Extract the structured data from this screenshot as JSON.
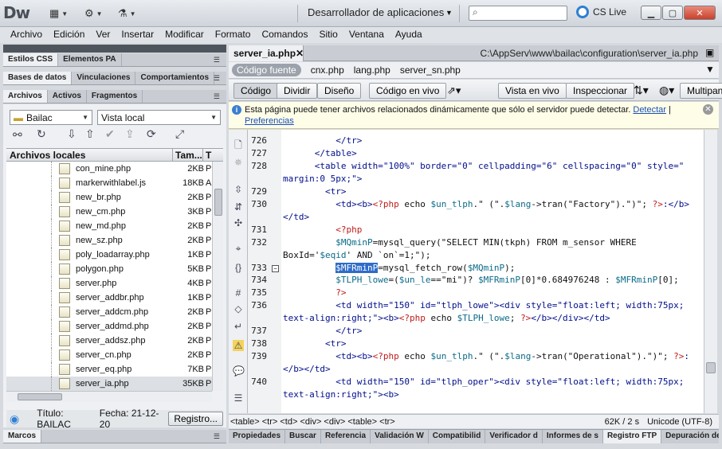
{
  "app": {
    "logo": "Dw",
    "workspace": "Desarrollador de aplicaciones",
    "cs_live": "CS Live"
  },
  "menu": [
    "Archivo",
    "Edición",
    "Ver",
    "Insertar",
    "Modificar",
    "Formato",
    "Comandos",
    "Sitio",
    "Ventana",
    "Ayuda"
  ],
  "panels": {
    "group1": [
      "Estilos CSS",
      "Elementos PA"
    ],
    "group2": [
      "Bases de datos",
      "Vinculaciones",
      "Comportamientos"
    ],
    "group3": [
      "Archivos",
      "Activos",
      "Fragmentos"
    ],
    "site_select": "Bailac",
    "view_select": "Vista local",
    "columns": {
      "name": "Archivos locales",
      "size": "Tam...",
      "type": "T"
    },
    "files": [
      {
        "name": "con_mine.php",
        "size": "2KB",
        "type": "P"
      },
      {
        "name": "markerwithlabel.js",
        "size": "18KB",
        "type": "A"
      },
      {
        "name": "new_br.php",
        "size": "2KB",
        "type": "P"
      },
      {
        "name": "new_cm.php",
        "size": "3KB",
        "type": "P"
      },
      {
        "name": "new_md.php",
        "size": "2KB",
        "type": "P"
      },
      {
        "name": "new_sz.php",
        "size": "2KB",
        "type": "P"
      },
      {
        "name": "poly_loadarray.php",
        "size": "1KB",
        "type": "P"
      },
      {
        "name": "polygon.php",
        "size": "5KB",
        "type": "P"
      },
      {
        "name": "server.php",
        "size": "4KB",
        "type": "P"
      },
      {
        "name": "server_addbr.php",
        "size": "1KB",
        "type": "P"
      },
      {
        "name": "server_addcm.php",
        "size": "2KB",
        "type": "P"
      },
      {
        "name": "server_addmd.php",
        "size": "2KB",
        "type": "P"
      },
      {
        "name": "server_addsz.php",
        "size": "2KB",
        "type": "P"
      },
      {
        "name": "server_cn.php",
        "size": "2KB",
        "type": "P"
      },
      {
        "name": "server_eq.php",
        "size": "7KB",
        "type": "P"
      },
      {
        "name": "server_ia.php",
        "size": "35KB",
        "type": "P"
      }
    ],
    "status": {
      "title": "Título: BAILAC",
      "date": "Fecha: 21-12-20",
      "button": "Registro..."
    },
    "marcos": "Marcos"
  },
  "document": {
    "tab": "server_ia.php",
    "path": "C:\\AppServ\\www\\bailac\\configuration\\server_ia.php",
    "related": [
      "Código fuente",
      "cnx.php",
      "lang.php",
      "server_sn.php"
    ],
    "toolbar": [
      "Código",
      "Dividir",
      "Diseño",
      "Código en vivo",
      "Vista en vivo",
      "Inspeccionar",
      "Multipant"
    ],
    "info_text": "Esta página puede tener archivos relacionados dinámicamente que sólo el servidor puede detectar.",
    "info_link1": "Detectar",
    "info_sep": "|",
    "info_link2": "Preferencias"
  },
  "code": {
    "line_numbers": [
      "726",
      "727",
      "728",
      "",
      "729",
      "730",
      "",
      "731",
      "732",
      "",
      "733",
      "734",
      "735",
      "736",
      "",
      "737",
      "738",
      "739",
      "",
      "740",
      ""
    ],
    "lines": [
      [
        {
          "c": "t",
          "x": "          </tr>"
        }
      ],
      [
        {
          "c": "t",
          "x": "      </table>"
        }
      ],
      [
        {
          "c": "t",
          "x": "      <table width=\"100%\" border=\"0\" cellpadding=\"6\" cellspacing=\"0\" style=\""
        }
      ],
      [
        {
          "c": "t",
          "x": "margin:0 5px;\">"
        }
      ],
      [
        {
          "c": "t",
          "x": "        <tr>"
        }
      ],
      [
        {
          "c": "t",
          "x": "          <td><b>"
        },
        {
          "c": "p",
          "x": "<?php"
        },
        {
          "c": "",
          "x": " echo "
        },
        {
          "c": "v",
          "x": "$un_tlph"
        },
        {
          "c": "",
          "x": ".\" (\"."
        },
        {
          "c": "v",
          "x": "$lang"
        },
        {
          "c": "",
          "x": "->tran(\"Factory\").\")\"; "
        },
        {
          "c": "p",
          "x": "?>"
        },
        {
          "c": "t",
          "x": ":</b>"
        }
      ],
      [
        {
          "c": "t",
          "x": "</td>"
        }
      ],
      [
        {
          "c": "p",
          "x": "          <?php"
        }
      ],
      [
        {
          "c": "v",
          "x": "          $MQminP"
        },
        {
          "c": "",
          "x": "=mysql_query(\"SELECT MIN(tkph) FROM m_sensor WHERE"
        }
      ],
      [
        {
          "c": "",
          "x": "BoxId='"
        },
        {
          "c": "v",
          "x": "$eqid"
        },
        {
          "c": "",
          "x": "' AND `on`=1;\");"
        }
      ],
      [
        {
          "c": "",
          "x": "          "
        },
        {
          "c": "sel-txt",
          "x": "$MFRminP"
        },
        {
          "c": "",
          "x": "=mysql_fetch_row("
        },
        {
          "c": "v",
          "x": "$MQminP"
        },
        {
          "c": "",
          "x": ");"
        }
      ],
      [
        {
          "c": "v",
          "x": "          $TLPH_lowe"
        },
        {
          "c": "",
          "x": "=("
        },
        {
          "c": "v",
          "x": "$un_le"
        },
        {
          "c": "",
          "x": "==\"mi\")? "
        },
        {
          "c": "v",
          "x": "$MFRminP"
        },
        {
          "c": "",
          "x": "[0]*0.684976248 : "
        },
        {
          "c": "v",
          "x": "$MFRminP"
        },
        {
          "c": "",
          "x": "[0];"
        }
      ],
      [
        {
          "c": "p",
          "x": "          ?>"
        }
      ],
      [
        {
          "c": "t",
          "x": "          <td width=\"150\" id=\"tlph_lowe\"><div style=\"float:left; width:75px;"
        }
      ],
      [
        {
          "c": "t",
          "x": "text-align:right;\"><b>"
        },
        {
          "c": "p",
          "x": "<?php"
        },
        {
          "c": "",
          "x": " echo "
        },
        {
          "c": "v",
          "x": "$TLPH_lowe"
        },
        {
          "c": "",
          "x": "; "
        },
        {
          "c": "p",
          "x": "?>"
        },
        {
          "c": "t",
          "x": "</b></div></td>"
        }
      ],
      [
        {
          "c": "t",
          "x": "          </tr>"
        }
      ],
      [
        {
          "c": "t",
          "x": "        <tr>"
        }
      ],
      [
        {
          "c": "t",
          "x": "          <td><b>"
        },
        {
          "c": "p",
          "x": "<?php"
        },
        {
          "c": "",
          "x": " echo "
        },
        {
          "c": "v",
          "x": "$un_tlph"
        },
        {
          "c": "",
          "x": ".\" (\"."
        },
        {
          "c": "v",
          "x": "$lang"
        },
        {
          "c": "",
          "x": "->tran(\"Operational\").\")\"; "
        },
        {
          "c": "p",
          "x": "?>"
        },
        {
          "c": "t",
          "x": ":"
        }
      ],
      [
        {
          "c": "t",
          "x": "</b></td>"
        }
      ],
      [
        {
          "c": "t",
          "x": "          <td width=\"150\" id=\"tlph_oper\"><div style=\"float:left; width:75px;"
        }
      ],
      [
        {
          "c": "t",
          "x": "text-align:right;\"><b>"
        }
      ]
    ]
  },
  "tagbar": {
    "tags": "<table> <tr> <td> <div> <div> <table> <tr>",
    "size": "62K / 2 s",
    "encoding": "Unicode (UTF-8)"
  },
  "bottom_tabs": [
    "Propiedades",
    "Buscar",
    "Referencia",
    "Validación W",
    "Compatibilid",
    "Verificador d",
    "Informes de s",
    "Registro FTP",
    "Depuración de"
  ]
}
